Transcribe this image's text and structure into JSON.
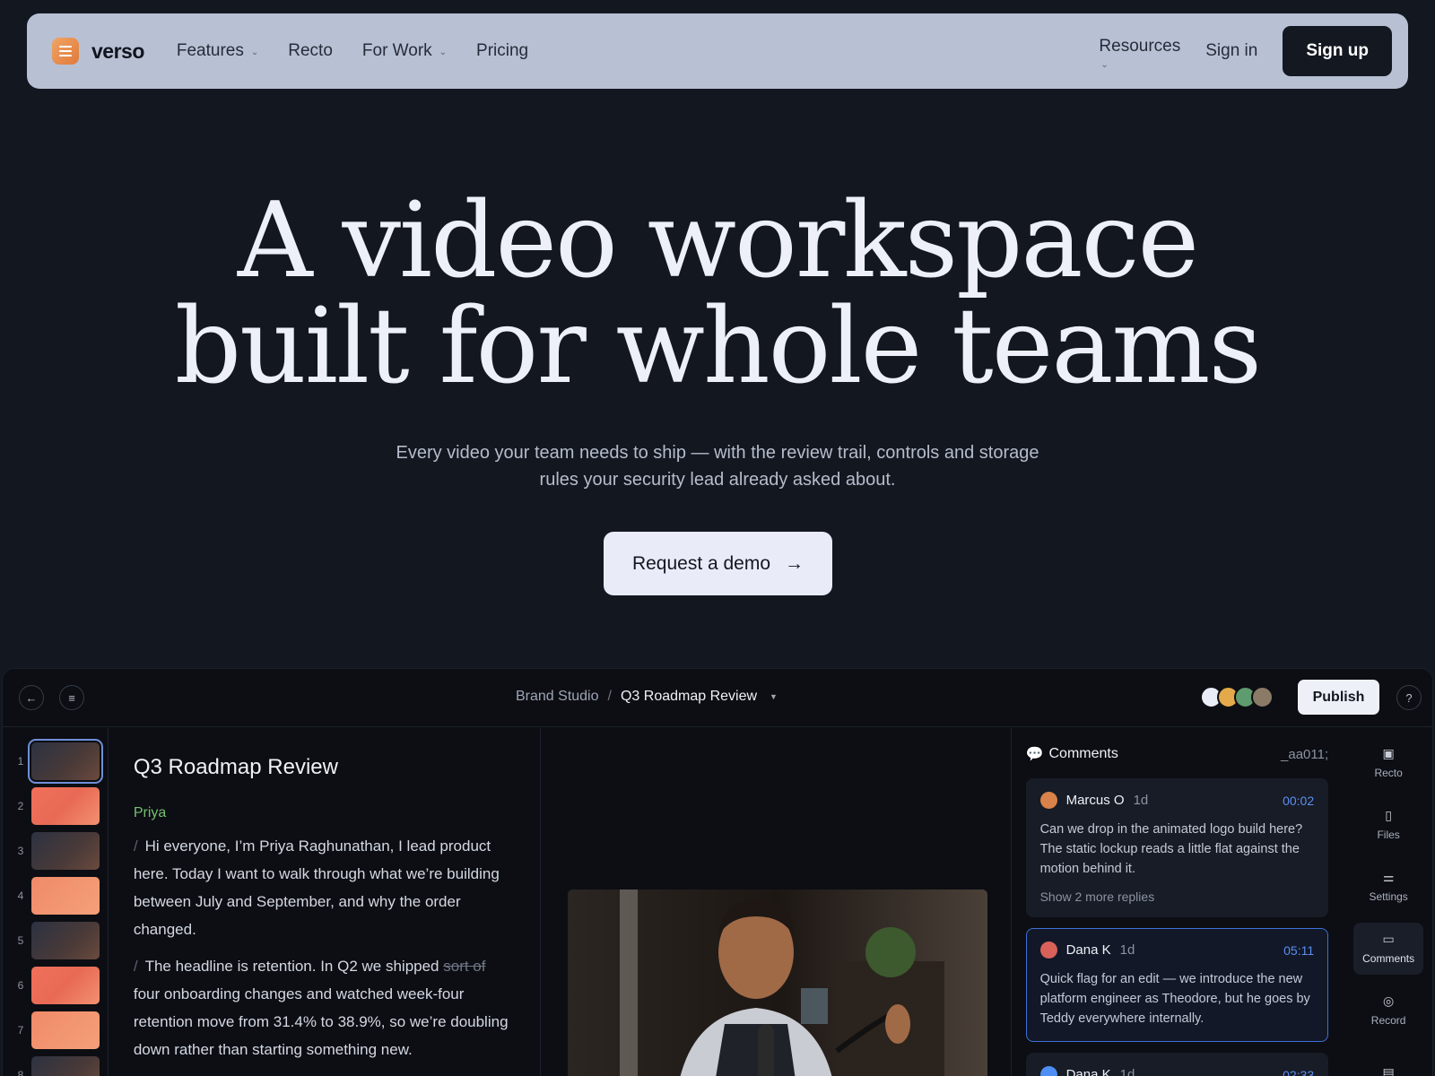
{
  "nav": {
    "brand": "verso",
    "links": [
      {
        "label": "Features",
        "has_dropdown": true
      },
      {
        "label": "Recto",
        "has_dropdown": false
      },
      {
        "label": "For Work",
        "has_dropdown": true
      },
      {
        "label": "Pricing",
        "has_dropdown": false
      }
    ],
    "resources": "Resources",
    "sign_in": "Sign in",
    "sign_up": "Sign up"
  },
  "hero": {
    "title_line1": "A video workspace",
    "title_line2": "built for whole teams",
    "subtitle_line1": "Every video your team needs to ship — with the review trail, controls and storage",
    "subtitle_line2": "rules your security lead already asked about.",
    "cta": "Request a demo",
    "cta_arrow": "→"
  },
  "app": {
    "breadcrumb": {
      "workspace": "Brand Studio",
      "separator": "/",
      "document": "Q3 Roadmap Review"
    },
    "publish": "Publish",
    "help": "?",
    "avatar_colors": [
      "#e9edf8",
      "#e3a94a",
      "#5e9b6e",
      "#8a7a66"
    ],
    "thumbnails": [
      {
        "num": "1",
        "style": "dark",
        "active": true
      },
      {
        "num": "2",
        "style": "coral",
        "active": false
      },
      {
        "num": "3",
        "style": "dark",
        "active": false
      },
      {
        "num": "4",
        "style": "peach",
        "active": false
      },
      {
        "num": "5",
        "style": "dark",
        "active": false
      },
      {
        "num": "6",
        "style": "coral",
        "active": false
      },
      {
        "num": "7",
        "style": "peach",
        "active": false
      },
      {
        "num": "8",
        "style": "dark",
        "active": false
      }
    ],
    "script": {
      "title": "Q3 Roadmap Review",
      "speaker": "Priya",
      "para1": "Hi everyone, I’m Priya Raghunathan, I lead product here. Today I want to walk through what we’re building between July and September, and why the order changed.",
      "para2_before": "The headline is retention. In Q2 we shipped",
      "para2_struck": "sort of",
      "para2_after": "four onboarding changes and watched week-four retention move from 31.4% to 38.9%, so we’re doubling down rather than starting something new."
    },
    "comments": {
      "title": "Comments",
      "code": "_aa011;",
      "items": [
        {
          "author": "Marcus O",
          "age": "1d",
          "time": "00:02",
          "color": "#d9824a",
          "text": "Can we drop in the animated logo build here? The static lockup reads a little flat against the motion behind it.",
          "more": "Show 2 more replies",
          "selected": false
        },
        {
          "author": "Dana K",
          "age": "1d",
          "time": "05:11",
          "color": "#d9615a",
          "text": "Quick flag for an edit — we introduce the new platform engineer as Theodore, but he goes by Teddy everywhere internally.",
          "more": "",
          "selected": true
        },
        {
          "author": "Dana K",
          "age": "1d",
          "time": "02:33",
          "color": "#4f8ef5",
          "text": "",
          "more": "",
          "selected": false
        }
      ]
    },
    "rail": [
      {
        "label": "Recto",
        "icon": "recto-icon",
        "active": false
      },
      {
        "label": "Files",
        "icon": "file-icon",
        "active": false
      },
      {
        "label": "Settings",
        "icon": "sliders-icon",
        "active": false
      },
      {
        "label": "Comments",
        "icon": "comment-icon",
        "active": true
      },
      {
        "label": "Record",
        "icon": "record-icon",
        "active": false
      }
    ]
  },
  "colors": {
    "background": "#131720",
    "nav_bg": "#b8c0d3",
    "accent_orange": "#e88a48",
    "accent_blue": "#5b8ef0",
    "speaker_green": "#74c06e"
  }
}
